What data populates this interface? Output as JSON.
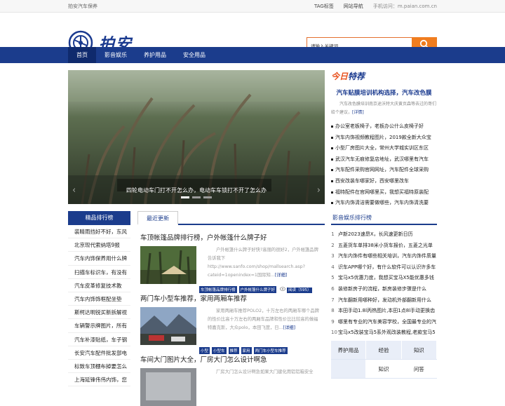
{
  "topbar": {
    "left": "拍安汽车保养",
    "tag": "TAG标签",
    "nav": "网站导航",
    "mobile": "手机访问：m.paian.com.cn"
  },
  "logo": {
    "name": "拍安"
  },
  "search": {
    "placeholder": "请输入关键词"
  },
  "nav": [
    "首页",
    "影音娱乐",
    "养护用品",
    "安全用品"
  ],
  "slider": {
    "caption": "四轮电动车门打不开怎么办，电动车车锁打不开了怎么办"
  },
  "today": {
    "t1": "今日",
    "t2": "特荐"
  },
  "featured": {
    "title": "汽车贴膜培训机构选择，汽车改色膜",
    "desc": "汽车改色膜培训南京途沃特大庆黄页森等去过的哥们给个建议，",
    "more": "[详情]"
  },
  "right_list": [
    "办公室老板椅子，老板办公什么皮椅子好",
    "汽车内饰视频教程图片，2019款全新大众宝",
    "小型厂房图片大全，常州大学城实训区东区",
    "武汉汽车无痕修复店地址，武汉哪里有汽车",
    "汽车配件采购官网网址，汽车配件全球采购",
    "西安改装车哪家好，西安哪里改车",
    "福特配件在官网哪里买，我想买福特原装配",
    "汽车内饰清洁需要做哪些，汽车内饰清洗要"
  ],
  "left_col": {
    "heading": "精品排行榜",
    "items": [
      "装睛雨挡好不好，东风",
      "北京现代索纳塔9报",
      "汽车内饰保养用什么牌",
      "扫描车标识车，有没有",
      "汽车皮革修复技术教",
      "汽车内饰饰框配坐垫",
      "斯柯达明锐买新拆解视",
      "车辆警示牌图片，所有",
      "汽车补漆贴纸，车子钢",
      "长安汽车配件批发部电",
      "标致车顶棚布掉要怎么",
      "上海延锋伟伟内饰，您"
    ]
  },
  "mid": {
    "heading": "最近更新",
    "articles": [
      {
        "title": "车顶帐篷品牌排行榜，户外帐篷什么牌子好",
        "desc": "户外帐篷什么牌子好快?高丽的很好2，户外帐篷品牌告诉我下http://www.sanfo.com/shop/mallsearch.asp?cateid=1openindex=1国际知...",
        "more": "[详细]",
        "tags": [
          "车顶帐篷品牌排行榜",
          "户外帐篷什么牌子好"
        ],
        "read": "阅读（595）"
      },
      {
        "title": "两门车小型车推荐，家用两厢车推荐",
        "desc": "家用两厢车推荐POLO2，十万左右的两厢车哪个品牌的性价比高十万左右的两厢车品牌和性价比比较高的做福特嘉克斯，大众polo，本田飞度，日...",
        "more": "[详细]",
        "tags": [
          "小型",
          "小型车",
          "推荐",
          "家用",
          "两门车小型车推荐"
        ],
        "read": ""
      },
      {
        "title": "车间大门图片大全，厂房大门怎么设计啊急",
        "desc": "厂房大门怎么设计啊急如果大门建化用铝铝箱安全",
        "more": "",
        "tags": [],
        "read": ""
      }
    ]
  },
  "rank": {
    "heading": "影音娱乐排行榜",
    "items": [
      "卢新2023速昂X，长风速更新日历",
      "五菱货车单排38米小货车报价，五菱之光单",
      "汽车内饰件有哪些相关培训，汽车内饰件质量",
      "识车APP哪个好，有什么软件可以认识许多车",
      "宝马x5优惠力度，我想买宝马X5能优惠多钱",
      "装修新房子的流程，新房装修步骤是什么",
      "汽车翻新用哪种好，发动机外部翻新用什么",
      "本田手动1.8l丙热图片,本田1点8l手动更换齿",
      "哪里有专业的汽车美容学校，全国最专业的汽",
      "宝马x5改装宝马5系外观改装教程,老款宝马5"
    ]
  },
  "grid": [
    [
      "养护用品",
      "经验",
      "知识"
    ],
    [
      "",
      "知识",
      "问答"
    ]
  ],
  "colors": {
    "brand": "#1b3c8c",
    "accent": "#f07d1f"
  }
}
